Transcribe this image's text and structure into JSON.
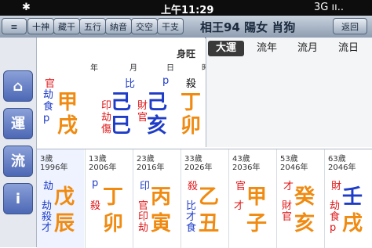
{
  "status": {
    "left": "3G ıı..",
    "time": "上午11:29",
    "right": "✱"
  },
  "nav": {
    "back": "返回",
    "title": "相王94 陽女 肖狗",
    "buttons": [
      "干支",
      "交空",
      "納音",
      "五行",
      "藏干",
      "十神"
    ]
  },
  "side": [
    "⌂",
    "運",
    "流",
    "i"
  ],
  "tabs": [
    "大運",
    "流年",
    "流月",
    "流日"
  ],
  "chart": {
    "header": "身旺",
    "labels": [
      "時",
      "日",
      "月",
      "年"
    ],
    "columns": [
      {
        "top": "殺",
        "stem": "丁",
        "branch": "卯",
        "sub": "p",
        "stem_color": "orange",
        "branch_color": "orange"
      },
      {
        "top": "p",
        "stem": "己",
        "branch": "亥",
        "sub": "財官",
        "stem_color": "blue",
        "branch_color": "blue"
      },
      {
        "top": "比",
        "stem": "己",
        "branch": "巳",
        "sub": "印劫傷",
        "stem_color": "blue",
        "branch_color": "blue"
      },
      {
        "top": "官",
        "stem": "甲",
        "branch": "戌",
        "sub": "劫食p",
        "stem_color": "orange",
        "branch_color": "orange"
      }
    ]
  },
  "dayun": [
    {
      "age": "63歲",
      "year": "2046年",
      "top": "財",
      "stem": "壬",
      "branch": "戌",
      "sub": "劫食p"
    },
    {
      "age": "53歲",
      "year": "2046年",
      "top": "才",
      "stem": "癸",
      "branch": "亥",
      "sub": "財官"
    },
    {
      "age": "43歲",
      "year": "2036年",
      "top": "官",
      "stem": "甲",
      "branch": "子",
      "sub": "才"
    },
    {
      "age": "33歲",
      "year": "2026年",
      "top": "殺",
      "stem": "乙",
      "branch": "丑",
      "sub": "比才食"
    },
    {
      "age": "23歲",
      "year": "2016年",
      "top": "印",
      "stem": "丙",
      "branch": "寅",
      "sub": "官印劫"
    },
    {
      "age": "13歲",
      "year": "2006年",
      "top": "p",
      "stem": "丁",
      "branch": "卯",
      "sub": "殺"
    },
    {
      "age": "3歲",
      "year": "1996年",
      "top": "劫",
      "stem": "戊",
      "branch": "辰",
      "sub": "劫殺才"
    }
  ]
}
